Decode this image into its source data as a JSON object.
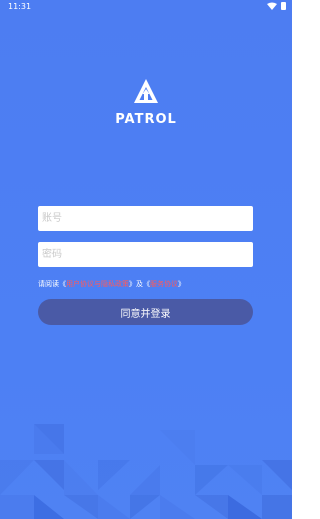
{
  "status_bar": {
    "time": "11:31"
  },
  "logo": {
    "text": "PATROL"
  },
  "form": {
    "account_placeholder": "账号",
    "password_placeholder": "密码"
  },
  "agreement": {
    "prefix": "请阅读《",
    "privacy_link": "用户协议与隐私政策",
    "middle": "》及《",
    "service_link": "服务协议",
    "suffix": "》"
  },
  "login_button": {
    "label": "同意并登录"
  },
  "colors": {
    "background": "#4d7df2",
    "button": "#4a5aa6",
    "link": "#ff5a5a"
  }
}
